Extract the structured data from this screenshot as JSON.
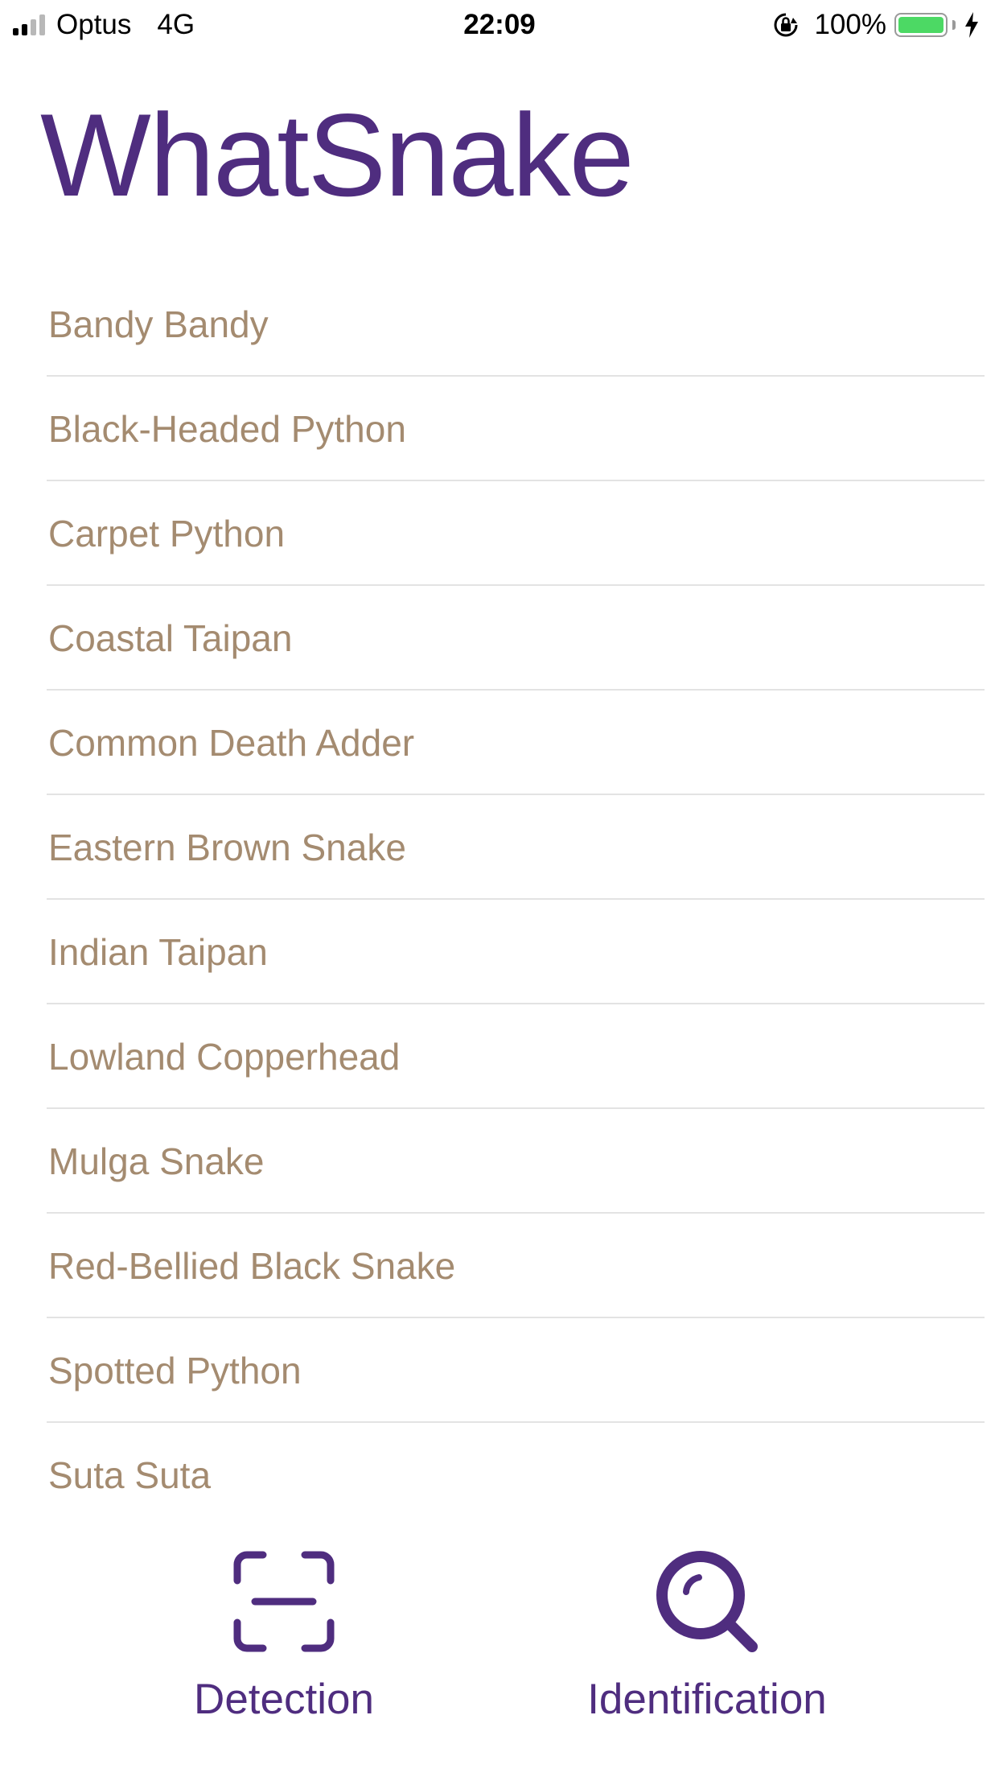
{
  "status_bar": {
    "carrier": "Optus",
    "network": "4G",
    "time": "22:09",
    "battery_percent": "100%",
    "battery_color": "#4cd964"
  },
  "app": {
    "title": "WhatSnake",
    "accent_color": "#4f2d7f",
    "item_text_color": "#a48b70"
  },
  "snake_list": {
    "items": [
      {
        "label": "Bandy Bandy"
      },
      {
        "label": "Black-Headed Python"
      },
      {
        "label": "Carpet Python"
      },
      {
        "label": "Coastal Taipan"
      },
      {
        "label": "Common Death Adder"
      },
      {
        "label": "Eastern Brown Snake"
      },
      {
        "label": "Indian Taipan"
      },
      {
        "label": "Lowland Copperhead"
      },
      {
        "label": "Mulga Snake"
      },
      {
        "label": "Red-Bellied Black Snake"
      },
      {
        "label": "Spotted Python"
      },
      {
        "label": "Suta Suta"
      }
    ]
  },
  "tab_bar": {
    "tabs": [
      {
        "label": "Detection",
        "icon": "scan-icon"
      },
      {
        "label": "Identification",
        "icon": "search-icon"
      }
    ]
  }
}
